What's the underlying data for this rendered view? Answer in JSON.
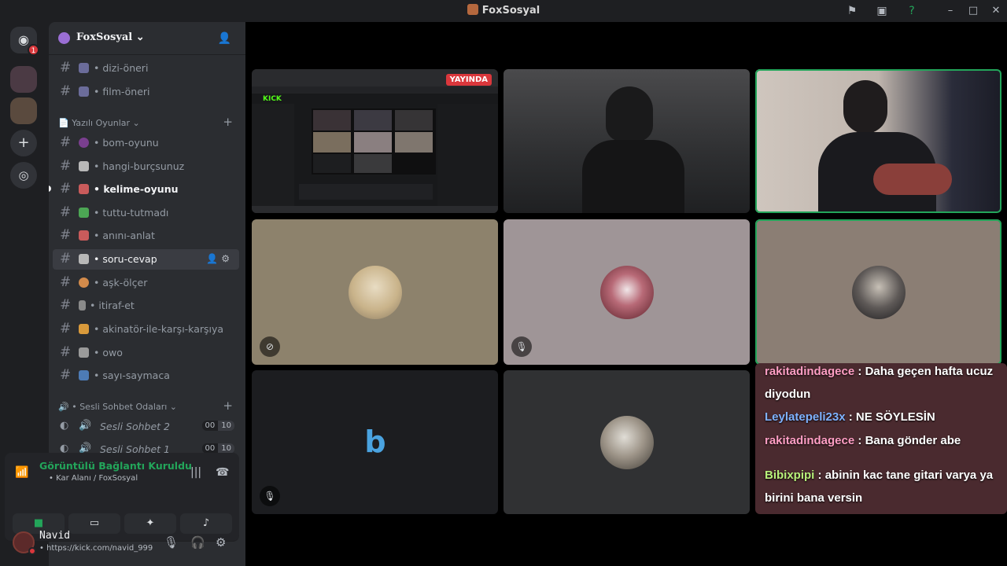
{
  "window": {
    "title": "FoxSosyal"
  },
  "server": {
    "name": "FoxSosyal"
  },
  "channels_top": [
    {
      "name": "dizi-öneri",
      "emoji_color": "#6b6c9a"
    },
    {
      "name": "film-öneri",
      "emoji_color": "#6b6c9a"
    }
  ],
  "category_games": {
    "label": "Yazılı Oyunlar"
  },
  "channels_games": [
    {
      "name": "bom-oyunu",
      "emoji_color": "#7a3f8f"
    },
    {
      "name": "hangi-burçsunuz",
      "emoji_color": "#b8b8b8"
    },
    {
      "name": "kelime-oyunu",
      "emoji_color": "#c95b5b"
    },
    {
      "name": "tuttu-tutmadı",
      "emoji_color": "#4ca654"
    },
    {
      "name": "anını-anlat",
      "emoji_color": "#c95b5b"
    },
    {
      "name": "soru-cevap",
      "emoji_color": "#b8b8b8"
    },
    {
      "name": "aşk-ölçer",
      "emoji_color": "#d38b4b"
    },
    {
      "name": "itiraf-et",
      "emoji_color": "#8a8a8a"
    },
    {
      "name": "akinatör-ile-karşı-karşıya",
      "emoji_color": "#d99a3b"
    },
    {
      "name": "owo",
      "emoji_color": "#9a9a9a"
    },
    {
      "name": "sayı-saymaca",
      "emoji_color": "#4d7bb5"
    }
  ],
  "category_voice": {
    "label": "Sesli Sohbet Odaları"
  },
  "voice_channels": [
    {
      "name": "Sesli Sohbet 2",
      "count": "00",
      "limit": "10"
    },
    {
      "name": "Sesli Sohbet 1",
      "count": "00",
      "limit": "10"
    }
  ],
  "voice_panel": {
    "status": "Görüntülü Bağlantı Kuruldu",
    "location": "Kar Alanı / FoxSosyal"
  },
  "user": {
    "name": "Navid",
    "status_text": "https://kick.com/navid_999"
  },
  "stream": {
    "live_label": "YAYINDA",
    "brand": "KICK"
  },
  "chat": [
    {
      "user": "rakitadindagece",
      "user_color": "#ff9ec4",
      "text": "Daha geçen hafta ucuz diyodun"
    },
    {
      "user": "Leylatepeli23x",
      "user_color": "#7fb2ff",
      "text": "NE SÖYLESİN"
    },
    {
      "user": "rakitadindagece",
      "user_color": "#ff9ec4",
      "text": "Bana gönder abe"
    },
    {
      "user": "Bibixpipi",
      "user_color": "#b7f07a",
      "text": "abinin kac tane gitari varya ya birini bana versin"
    }
  ],
  "colors": {
    "accent_green": "#23a55a",
    "danger": "#da373c",
    "sidebar": "#2b2d31"
  }
}
